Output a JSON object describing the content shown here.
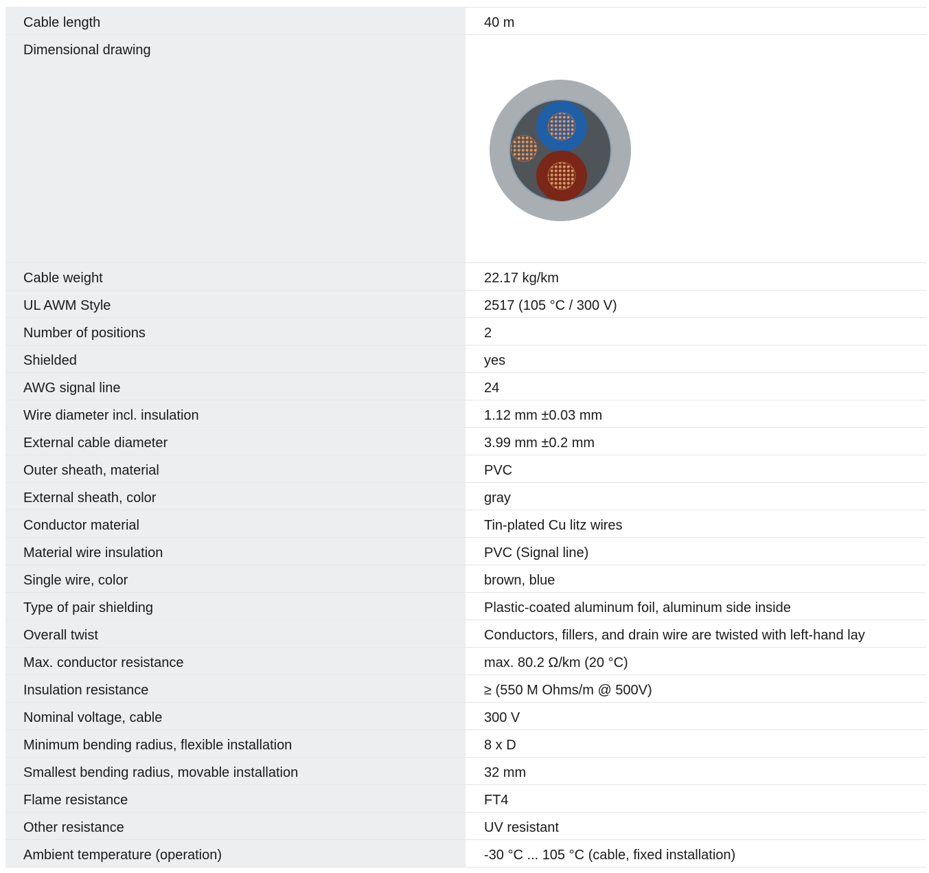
{
  "rows": [
    {
      "label": "Cable length",
      "value": "40 m"
    },
    {
      "label": "Dimensional drawing",
      "value": ""
    },
    {
      "label": "Cable weight",
      "value": "22.17 kg/km"
    },
    {
      "label": "UL AWM Style",
      "value": "2517 (105 °C / 300 V)"
    },
    {
      "label": "Number of positions",
      "value": "2"
    },
    {
      "label": "Shielded",
      "value": "yes"
    },
    {
      "label": "AWG signal line",
      "value": "24"
    },
    {
      "label": "Wire diameter incl. insulation",
      "value": "1.12 mm ±0.03 mm"
    },
    {
      "label": "External cable diameter",
      "value": "3.99 mm ±0.2 mm"
    },
    {
      "label": "Outer sheath, material",
      "value": "PVC"
    },
    {
      "label": "External sheath, color",
      "value": "gray"
    },
    {
      "label": "Conductor material",
      "value": "Tin-plated Cu litz wires"
    },
    {
      "label": "Material wire insulation",
      "value": "PVC (Signal line)"
    },
    {
      "label": "Single wire, color",
      "value": "brown, blue"
    },
    {
      "label": "Type of pair shielding",
      "value": "Plastic-coated aluminum foil, aluminum side inside"
    },
    {
      "label": "Overall twist",
      "value": "Conductors, fillers, and drain wire are twisted with left-hand lay"
    },
    {
      "label": "Max. conductor resistance",
      "value": "max. 80.2 Ω/km (20 °C)"
    },
    {
      "label": "Insulation resistance",
      "value": "≥ (550 M Ohms/m @ 500V)"
    },
    {
      "label": "Nominal voltage, cable",
      "value": "300 V"
    },
    {
      "label": "Minimum bending radius, flexible installation",
      "value": "8 x D"
    },
    {
      "label": "Smallest bending radius, movable installation",
      "value": "32 mm"
    },
    {
      "label": "Flame resistance",
      "value": "FT4"
    },
    {
      "label": "Other resistance",
      "value": "UV resistant"
    },
    {
      "label": "Ambient temperature (operation)",
      "value": "-30 °C ... 105 °C (cable, fixed installation)"
    }
  ],
  "drawing": {
    "icon": "cable-cross-section-icon",
    "colors": {
      "sheath": "#a9aeb3",
      "core_fill": "#4f5459",
      "blue_wire": "#1f5fa8",
      "brown_wire": "#7a2718",
      "copper": "#c98355"
    }
  }
}
